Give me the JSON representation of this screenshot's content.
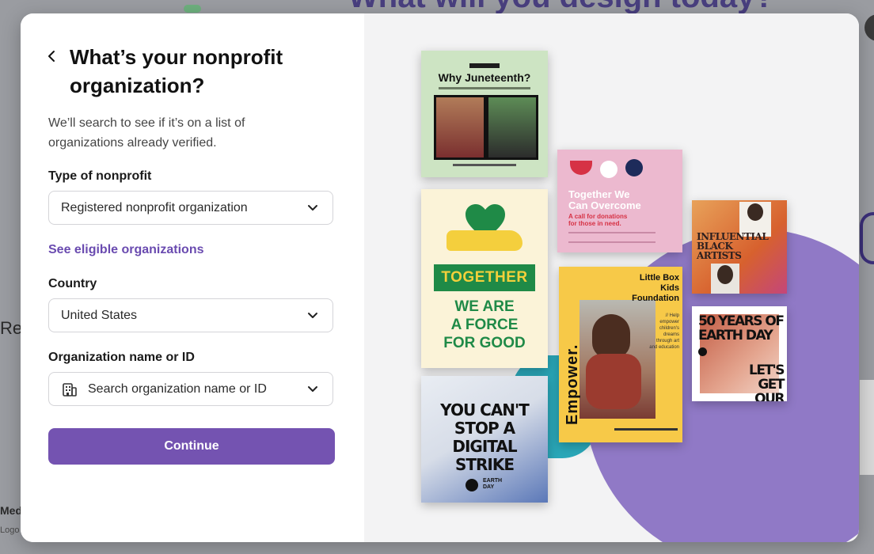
{
  "background": {
    "heading": "What will you design today?",
    "left_fragment_1": "Re",
    "left_fragment_2": "Med",
    "left_fragment_3": "Logo"
  },
  "modal": {
    "title": "What’s your nonprofit organization?",
    "subtitle": "We’ll search to see if it’s on a list of organizations already verified.",
    "type_label": "Type of nonprofit",
    "type_value": "Registered nonprofit organization",
    "eligible_link": "See eligible organizations",
    "country_label": "Country",
    "country_value": "United States",
    "org_label": "Organization name or ID",
    "org_placeholder": "Search organization name or ID",
    "continue_label": "Continue",
    "accent_color": "#7453b1"
  },
  "showcase": {
    "card1": {
      "title": "Why Juneteenth?"
    },
    "card2": {
      "band": "TOGETHER",
      "body": "WE ARE\nA FORCE\nFOR GOOD"
    },
    "card3": {
      "title": "YOU CAN'T\nSTOP A\nDIGITAL STRIKE",
      "mini": "EARTH\nDAY"
    },
    "card4": {
      "title": "Together We\nCan Overcome",
      "sub": "A call for donations\nfor those in need."
    },
    "card5": {
      "side": "Empower.",
      "header": "Little Box\nKids\nFoundation",
      "text": "// Help empower children's dreams through art and education"
    },
    "card6": {
      "title": "INFLUENTIAL\nBLACK\nARTISTS"
    },
    "card7": {
      "top": "50 YEARS OF\nEARTH DAY",
      "bottom": "LET'S GET\nOUR WAY!"
    }
  }
}
